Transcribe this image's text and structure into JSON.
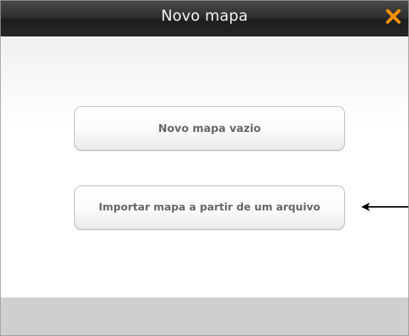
{
  "dialog": {
    "title": "Novo mapa",
    "close_icon": "close-icon",
    "accent_color": "#f39200"
  },
  "buttons": {
    "new_empty_map": "Novo mapa vazio",
    "import_from_file": "Importar mapa a partir de um arquivo"
  },
  "annotation": {
    "icon": "arrow-left-icon"
  }
}
